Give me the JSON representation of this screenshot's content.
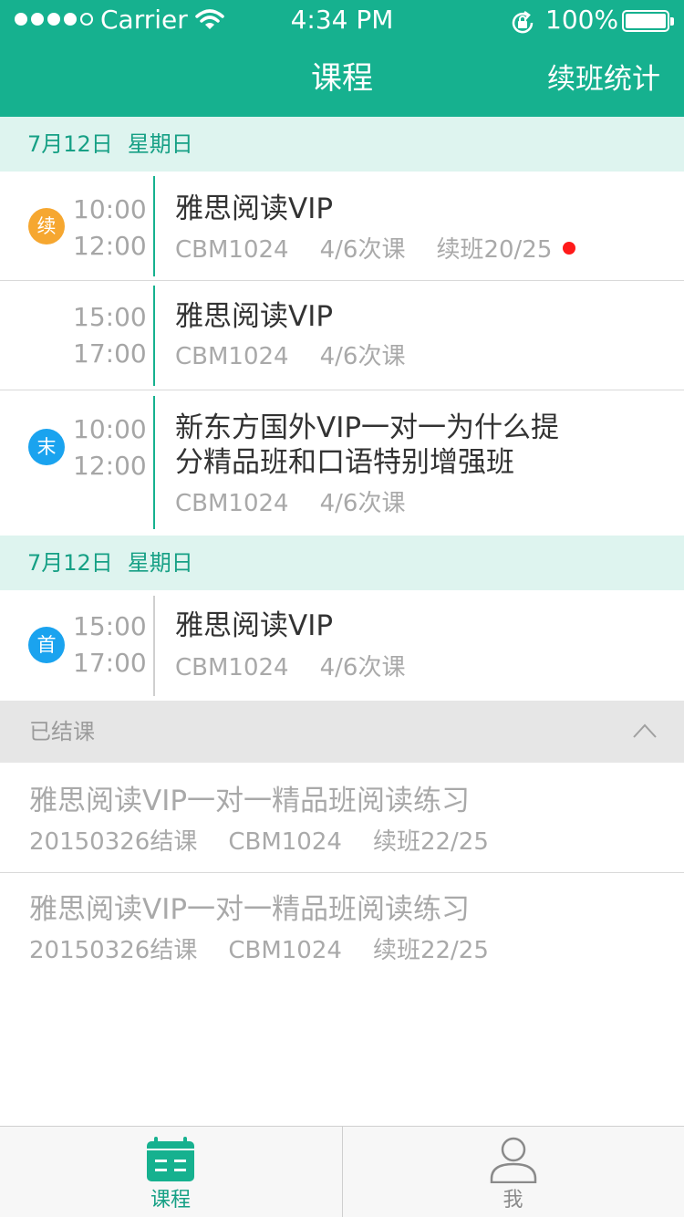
{
  "status_bar": {
    "carrier": "Carrier",
    "time": "4:34 PM",
    "battery": "100%"
  },
  "header": {
    "title": "课程",
    "right_action": "续班统计"
  },
  "sections": [
    {
      "date": "7月12日",
      "weekday": "星期日",
      "rows": [
        {
          "badge": "续",
          "badge_color": "#f6a730",
          "start": "10:00",
          "end": "12:00",
          "title": "雅思阅读VIP",
          "code": "CBM1024",
          "progress": "4/6次课",
          "renew": "续班20/25",
          "alert": true
        },
        {
          "badge": "",
          "start": "15:00",
          "end": "17:00",
          "title": "雅思阅读VIP",
          "code": "CBM1024",
          "progress": "4/6次课"
        },
        {
          "badge": "末",
          "badge_color": "#1aa3ef",
          "start": "10:00",
          "end": "12:00",
          "title": "新东方国外VIP一对一为什么提分精品班和口语特别增强班",
          "code": "CBM1024",
          "progress": "4/6次课"
        }
      ]
    },
    {
      "date": "7月12日",
      "weekday": "星期日",
      "rows": [
        {
          "badge": "首",
          "badge_color": "#1aa3ef",
          "start": "15:00",
          "end": "17:00",
          "title": "雅思阅读VIP",
          "code": "CBM1024",
          "progress": "4/6次课"
        }
      ]
    }
  ],
  "finished": {
    "label": "已结课",
    "items": [
      {
        "title": "雅思阅读VIP一对一精品班阅读练习",
        "end_date": "20150326结课",
        "code": "CBM1024",
        "renew": "续班22/25"
      },
      {
        "title": "雅思阅读VIP一对一精品班阅读练习",
        "end_date": "20150326结课",
        "code": "CBM1024",
        "renew": "续班22/25"
      }
    ]
  },
  "tabbar": {
    "tabs": [
      {
        "label": "课程",
        "icon": "calendar-icon",
        "active": true
      },
      {
        "label": "我",
        "icon": "person-icon",
        "active": false
      }
    ]
  },
  "colors": {
    "brand": "#16b18f",
    "date_bg": "#def4ef",
    "alert": "#ff1a1a"
  }
}
